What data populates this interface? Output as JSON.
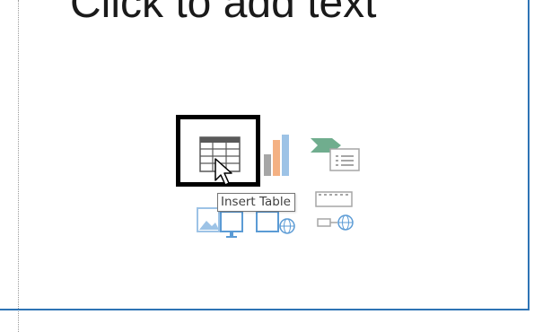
{
  "slide": {
    "placeholder_text": "Click to add text"
  },
  "content_icons": {
    "items": [
      {
        "name": "Insert Table",
        "icon": "table-icon",
        "highlighted": true
      },
      {
        "name": "chart",
        "icon": "chart-icon"
      },
      {
        "name": "smartart",
        "icon": "smartart-icon"
      },
      {
        "name": "pictures",
        "icon": "pictures-icon"
      },
      {
        "name": "online-pictures",
        "icon": "online-pictures-icon"
      },
      {
        "name": "video",
        "icon": "video-icon"
      }
    ],
    "tooltip": "Insert Table"
  },
  "colors": {
    "accent_blue": "#2e74b5",
    "icon_light_blue": "#9dc3e6",
    "icon_gray": "#a6a6a6",
    "icon_green": "#70ad8e",
    "icon_orange": "#f4b183"
  }
}
